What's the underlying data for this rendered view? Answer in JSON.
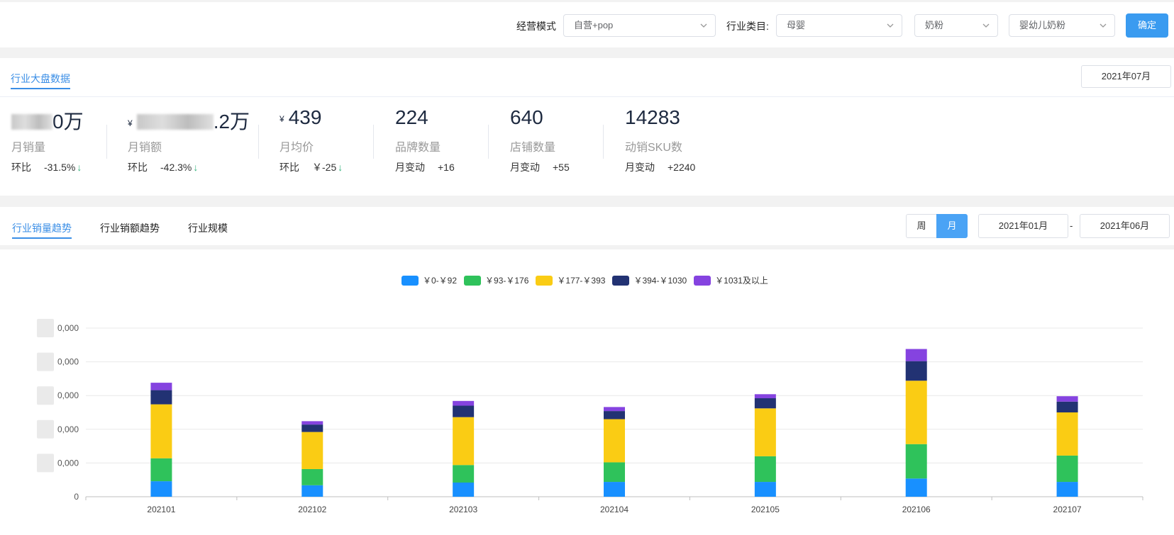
{
  "filters": {
    "mode_label": "经营模式",
    "mode_value": "自营+pop",
    "industry_label": "行业类目:",
    "category1": "母婴",
    "category2": "奶粉",
    "category3": "婴幼儿奶粉",
    "confirm": "确定"
  },
  "market": {
    "tab": "行业大盘数据",
    "month": "2021年07月",
    "kpis": [
      {
        "value_suffix": "0万",
        "label": "月销量",
        "change_label": "环比",
        "change": "-31.5%"
      },
      {
        "value_suffix": ".2万",
        "yen": "¥",
        "label": "月销额",
        "change_label": "环比",
        "change": "-42.3%"
      },
      {
        "value": "439",
        "yen": "¥",
        "label": "月均价",
        "change_label": "环比",
        "change": "￥-25"
      },
      {
        "value": "224",
        "label": "品牌数量",
        "change_label": "月变动",
        "change": "+16"
      },
      {
        "value": "640",
        "label": "店铺数量",
        "change_label": "月变动",
        "change": "+55"
      },
      {
        "value": "14283",
        "label": "动销SKU数",
        "change_label": "月变动",
        "change": "+2240"
      }
    ],
    "down_arrow": "↓"
  },
  "trend": {
    "tabs": [
      "行业销量趋势",
      "行业销额趋势",
      "行业规模"
    ],
    "week": "周",
    "month": "月",
    "start": "2021年01月",
    "dash": "-",
    "end": "2021年06月"
  },
  "chart_data": {
    "type": "bar",
    "stacked": true,
    "categories": [
      "202101",
      "202102",
      "202103",
      "202104",
      "202105",
      "202106",
      "202107"
    ],
    "series": [
      {
        "name": "￥0-￥92",
        "color": "#1890ff",
        "values": [
          23000,
          17000,
          21000,
          22000,
          22000,
          27000,
          22000
        ]
      },
      {
        "name": "￥93-￥176",
        "color": "#2fc25b",
        "values": [
          34000,
          24000,
          26000,
          29000,
          38000,
          51000,
          39000
        ]
      },
      {
        "name": "￥177-￥393",
        "color": "#facc14",
        "values": [
          80000,
          55000,
          71000,
          64000,
          71000,
          94000,
          64000
        ]
      },
      {
        "name": "￥394-￥1030",
        "color": "#223273",
        "values": [
          21000,
          11000,
          17000,
          12000,
          15000,
          29000,
          16000
        ]
      },
      {
        "name": "￥1031及以上",
        "color": "#8543e0",
        "values": [
          11000,
          5000,
          7000,
          6000,
          6000,
          18000,
          8000
        ]
      }
    ],
    "y_ticks": [
      "0,000",
      "0,000",
      "0,000",
      "0,000",
      "0,000",
      "0"
    ],
    "ylim": [
      0,
      250000
    ],
    "y_step": 50000,
    "grid": true,
    "legend": "top-center"
  }
}
